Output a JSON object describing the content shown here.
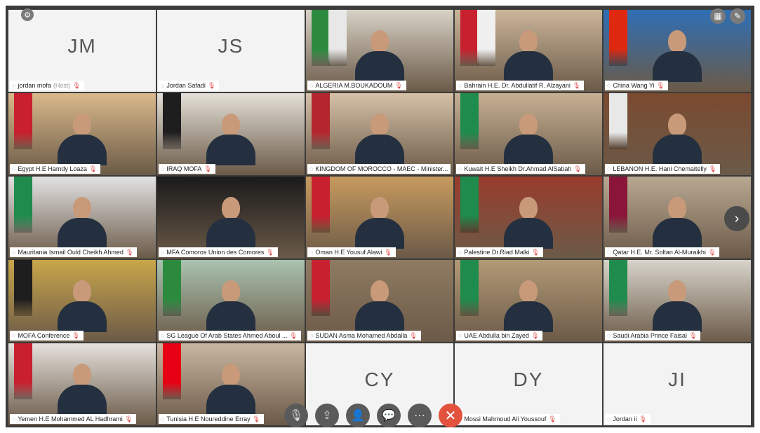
{
  "tiles": [
    {
      "name": "jordan-mofa",
      "initials": "JM",
      "label": "jordan mofa",
      "label_suffix": "(Host)",
      "type": "avatar"
    },
    {
      "name": "jordan-safadi",
      "initials": "JS",
      "label": "Jordan Safadi",
      "type": "avatar"
    },
    {
      "name": "algeria",
      "label": "ALGERIA M.BOUKADOUM",
      "type": "video",
      "wall": "#d8d2c6",
      "flags": [
        "#2c8a3f",
        "#e8e8e8"
      ]
    },
    {
      "name": "bahrain",
      "label": "Bahrain H.E. Dr. Abdullatif R. Alzayani",
      "type": "video",
      "wall": "#cbb59a",
      "flags": [
        "#c8202f",
        "#f0f0f0"
      ]
    },
    {
      "name": "china",
      "label": "China Wang Yi",
      "type": "video",
      "wall": "#2f6fb5",
      "flags": [
        "#de2910"
      ]
    },
    {
      "name": "egypt",
      "label": "Egypt H.E Hamdy Loaza",
      "type": "video",
      "wall": "#d9b98a",
      "flags": [
        "#c8202f"
      ]
    },
    {
      "name": "iraq",
      "label": "IRAQ MOFA",
      "type": "video",
      "wall": "#e4e0d8",
      "flags": [
        "#1e1e1e"
      ]
    },
    {
      "name": "morocco",
      "label": "KINGDOM OF MOROCCO - MAEC - Minister...",
      "type": "video",
      "wall": "#d6c1a8",
      "flags": [
        "#b3262d"
      ]
    },
    {
      "name": "kuwait",
      "label": "Kuwait H.E Sheikh Dr.Ahmad AlSabah",
      "type": "video",
      "wall": "#c7b194",
      "flags": [
        "#1f8b4c"
      ]
    },
    {
      "name": "lebanon",
      "label": "LEBANON H.E. Hani Chemaitelly",
      "type": "video",
      "wall": "#7b4a30",
      "flags": [
        "#e8e8e8"
      ]
    },
    {
      "name": "mauritania",
      "label": "Mauritania Ismail Ould Cheikh Ahmed",
      "type": "video",
      "wall": "#e2e2e2",
      "flags": [
        "#1f8b4c"
      ]
    },
    {
      "name": "comoros",
      "label": "MFA Comoros Union des Comores",
      "type": "video",
      "wall": "#1a1a1a",
      "flags": []
    },
    {
      "name": "oman",
      "label": "Oman H.E Yousuf Alawi",
      "type": "video",
      "wall": "#c79a5e",
      "flags": [
        "#c8202f"
      ],
      "active": true
    },
    {
      "name": "palestine",
      "label": "Palestine Dr.Riad Malki",
      "type": "video",
      "wall": "#9a3c2c",
      "flags": [
        "#1f8b4c"
      ]
    },
    {
      "name": "qatar",
      "label": "Qatar H.E. Mr. Soltan Al-Muraikhi",
      "type": "video",
      "wall": "#b8a892",
      "flags": [
        "#8a1538"
      ]
    },
    {
      "name": "mofa-conference",
      "label": "MOFA Conference",
      "type": "video",
      "wall": "#c8a64a",
      "flags": [
        "#1e1e1e"
      ]
    },
    {
      "name": "league-arab-states",
      "label": "SG League Of Arab States Ahmed Aboul ...",
      "type": "video",
      "wall": "#a9c3b0",
      "flags": [
        "#2c8a3f"
      ]
    },
    {
      "name": "sudan",
      "label": "SUDAN Asma Mohamed Abdalla",
      "type": "video",
      "wall": "#8f7b62",
      "flags": [
        "#c8202f"
      ]
    },
    {
      "name": "uae",
      "label": "UAE Abdulla bin Zayed",
      "type": "video",
      "wall": "#b39a76",
      "flags": [
        "#1f8b4c"
      ]
    },
    {
      "name": "saudi-arabia",
      "label": "Saudi Arabia Prince Faisal",
      "type": "video",
      "wall": "#d8d4cb",
      "flags": [
        "#1f8b4c"
      ]
    },
    {
      "name": "yemen",
      "label": "Yemen H.E Mohammed AL Hadhrami",
      "type": "video",
      "wall": "#e5e1dc",
      "flags": [
        "#c8202f"
      ]
    },
    {
      "name": "tunisia",
      "label": "Tunisia H.E Noureddine Erray",
      "type": "video",
      "wall": "#c9b6a2",
      "flags": [
        "#e70013"
      ]
    },
    {
      "name": "cy",
      "initials": "CY",
      "label": "",
      "type": "avatar"
    },
    {
      "name": "dy",
      "initials": "DY",
      "label": "Mossi Mahmoud Ali Youssouf",
      "type": "avatar"
    },
    {
      "name": "ji",
      "initials": "JI",
      "label": "Jordan ii",
      "type": "avatar"
    }
  ],
  "toolbar": [
    "mic-icon",
    "share-screen-icon",
    "participants-icon",
    "chat-icon",
    "more-icon",
    "end-call-icon"
  ]
}
